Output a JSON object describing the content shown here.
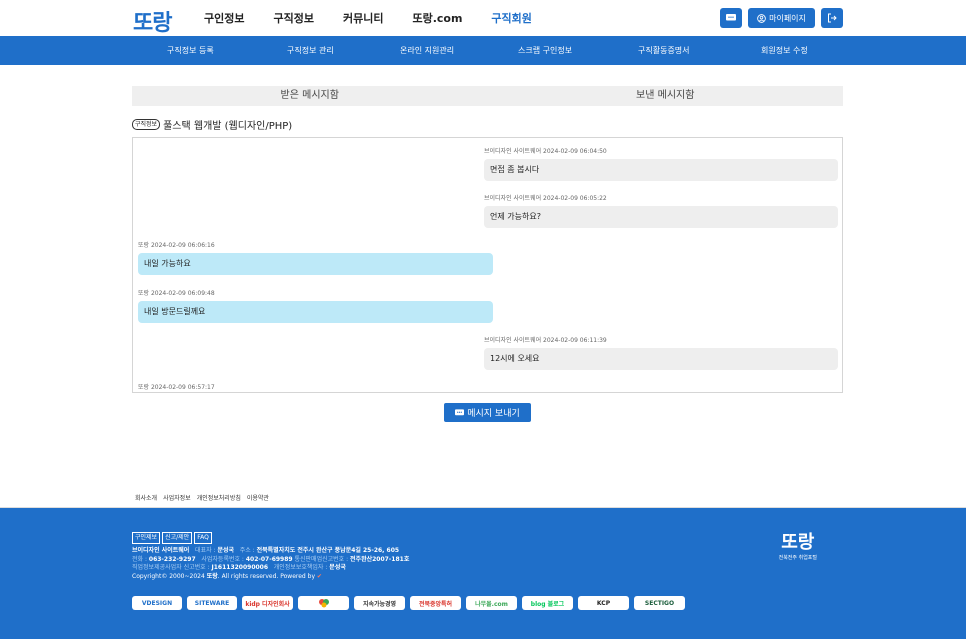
{
  "header": {
    "logo": "또랑",
    "nav": [
      "구인정보",
      "구직정보",
      "커뮤니티",
      "또랑.com",
      "구직회원"
    ],
    "active_nav": "구직회원",
    "mypage_label": "마이페이지"
  },
  "subnav": [
    "구직정보 등록",
    "구직정보 관리",
    "온라인 지원관리",
    "스크랩 구인정보",
    "구직활동증명서",
    "회원정보 수정"
  ],
  "tabs": [
    "받은 메시지함",
    "보낸 메시지함"
  ],
  "job": {
    "badge": "구직정보",
    "title": "풀스택 웹개발 (웹디자인/PHP)"
  },
  "messages": [
    {
      "type": "recv",
      "meta": "브이디자인 사이트웨어 2024-02-09 06:04:50",
      "text": "면접 좀 봅시다"
    },
    {
      "type": "recv",
      "meta": "브이디자인 사이트웨어 2024-02-09 06:05:22",
      "text": "언제 가능하요?"
    },
    {
      "type": "sent",
      "meta": "또랑 2024-02-09 06:06:16",
      "text": "내일 가능하요"
    },
    {
      "type": "sent",
      "meta": "또랑 2024-02-09 06:09:48",
      "text": "내일 방문드릴께요"
    },
    {
      "type": "recv",
      "meta": "브이디자인 사이트웨어 2024-02-09 06:11:39",
      "text": "12시에 오세요"
    },
    {
      "type": "sent",
      "meta": "또랑 2024-02-09 06:57:17",
      "text": ""
    }
  ],
  "send_button": "메시지 보내기",
  "footer": {
    "links": [
      "회사소개",
      "사업자정보",
      "개인정보처리방침",
      "이용약관"
    ],
    "buttons": [
      "구인제보",
      "신고/제안",
      "FAQ"
    ],
    "company": "브이디자인 사이트웨어",
    "ceo_label": "대표자 : ",
    "ceo": "문성국",
    "addr_label": "주소 : ",
    "address": "전북특별자치도 전주시 완산구 풍남문4길 25-26, 605",
    "phone_label": "전화 : ",
    "phone": "063-232-9297",
    "bizno_label": "사업자등록번호 : ",
    "bizno": "402-07-69989",
    "mailorder_label": "통신판매업신고번호 : ",
    "mailorder": "전주완산2007-181호",
    "job_reg_label": "직업정보제공사업자 신고번호 : ",
    "job_reg": "J1611320090006",
    "privacy_label": "개인정보보호책임자 : ",
    "privacy_officer": "문성국",
    "copyright_prefix": "Copyright© 2000~2024 ",
    "copyright_brand": "또랑",
    "copyright_suffix": ". All rights reserved. Powered by ",
    "logo": "또랑",
    "logo_sub": "전북전주 취업포털",
    "badges": [
      "VDESIGN",
      "SITEWARE",
      "kidp 디자인회사",
      "",
      "지속가능경영",
      "전북중앙특허",
      "나무몰.com",
      "blog 블로그",
      "KCP",
      "SECTIGO"
    ]
  }
}
